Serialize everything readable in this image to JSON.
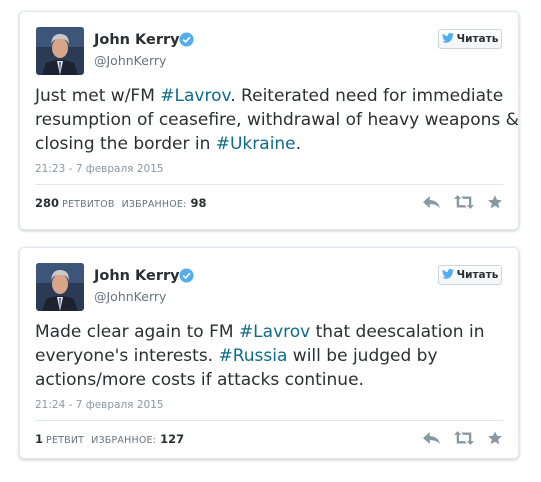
{
  "colors": {
    "hashtag": "#0f6b87",
    "muted": "#8899a6",
    "verified": "#55acee",
    "twitter_bird": "#55acee",
    "icon": "#8899a6"
  },
  "tweets": [
    {
      "author": {
        "name": "John Kerry",
        "handle": "@JohnKerry",
        "verified": true
      },
      "follow_label": "Читать",
      "text_lines": [
        [
          {
            "t": "Just met w/FM "
          },
          {
            "t": "#Lavrov",
            "tag": true
          },
          {
            "t": ". Reiterated need for immediate"
          }
        ],
        [
          {
            "t": "resumption of ceasefire, withdrawal of heavy weapons &"
          }
        ],
        [
          {
            "t": "closing the border in "
          },
          {
            "t": "#Ukraine",
            "tag": true
          },
          {
            "t": "."
          }
        ]
      ],
      "timestamp": "21:23 - 7 февраля 2015",
      "retweets": {
        "count": "280",
        "label": "РЕТВИТОВ"
      },
      "favorites": {
        "label": "ИЗБРАННОЕ:",
        "count": "98"
      },
      "actions": [
        "reply-icon",
        "retweet-icon",
        "favorite-icon"
      ]
    },
    {
      "author": {
        "name": "John Kerry",
        "handle": "@JohnKerry",
        "verified": true
      },
      "follow_label": "Читать",
      "text_lines": [
        [
          {
            "t": "Made clear again to FM "
          },
          {
            "t": "#Lavrov",
            "tag": true
          },
          {
            "t": " that deescalation in"
          }
        ],
        [
          {
            "t": "everyone's interests. "
          },
          {
            "t": "#Russia",
            "tag": true
          },
          {
            "t": " will be judged by"
          }
        ],
        [
          {
            "t": "actions/more costs if attacks continue."
          }
        ]
      ],
      "timestamp": "21:24 - 7 февраля 2015",
      "retweets": {
        "count": "1",
        "label": "РЕТВИТ"
      },
      "favorites": {
        "label": "ИЗБРАННОЕ:",
        "count": "127"
      },
      "actions": [
        "reply-icon",
        "retweet-icon",
        "favorite-icon"
      ]
    }
  ]
}
